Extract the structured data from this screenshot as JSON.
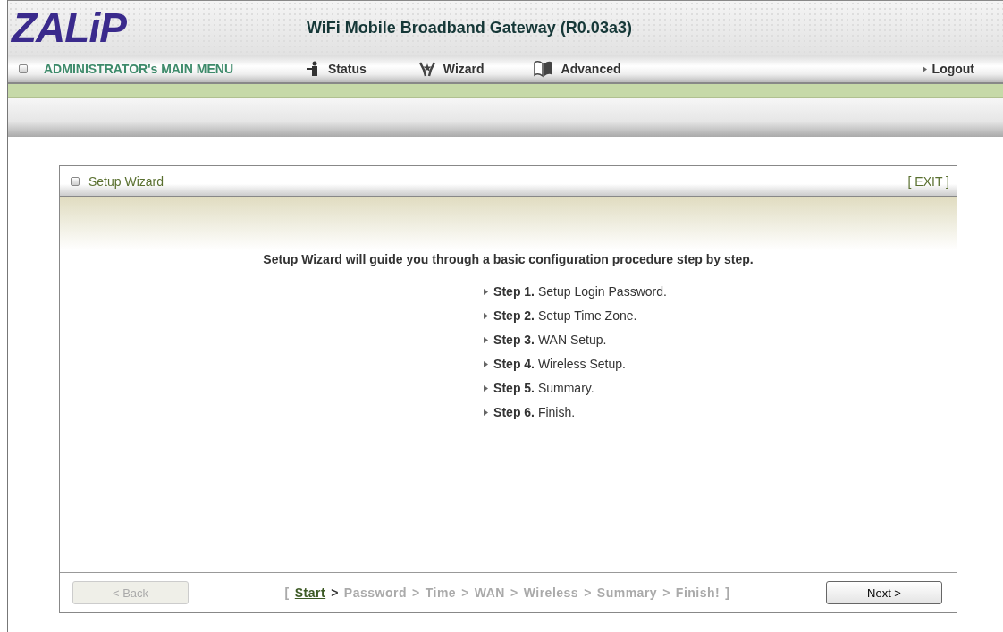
{
  "header": {
    "logo": "ZALiP",
    "title": "WiFi Mobile Broadband Gateway (R0.03a3)"
  },
  "nav": {
    "menu_title": "ADMINISTRATOR's MAIN MENU",
    "items": [
      {
        "kind": "status",
        "label": "Status"
      },
      {
        "kind": "wizard",
        "label": "Wizard"
      },
      {
        "kind": "advanced",
        "label": "Advanced"
      }
    ],
    "logout": "Logout"
  },
  "panel": {
    "title": "Setup Wizard",
    "exit": "[ EXIT ]",
    "intro": "Setup Wizard will guide you through a basic configuration procedure step by step.",
    "steps": [
      "**Step 1.** Setup Login Password.",
      "**Step 2.** Setup Time Zone.",
      "**Step 3.** WAN Setup.",
      "**Step 4.** Wireless Setup.",
      "**Step 5.** Summary.",
      "**Step 6.** Finish."
    ]
  },
  "footer": {
    "back": {
      "label": "< Back",
      "disabled": true
    },
    "progress": {
      "open": "[",
      "close": "]",
      "separator": ">",
      "steps": [
        {
          "label": "Start",
          "selected": true
        },
        {
          "label": "Password",
          "selected": false
        },
        {
          "label": "Time",
          "selected": false
        },
        {
          "label": "WAN",
          "selected": false
        },
        {
          "label": "Wireless",
          "selected": false
        },
        {
          "label": "Summary",
          "selected": false
        },
        {
          "label": "Finish!",
          "selected": false
        }
      ]
    },
    "next": {
      "label": "Next >",
      "disabled": false
    }
  }
}
